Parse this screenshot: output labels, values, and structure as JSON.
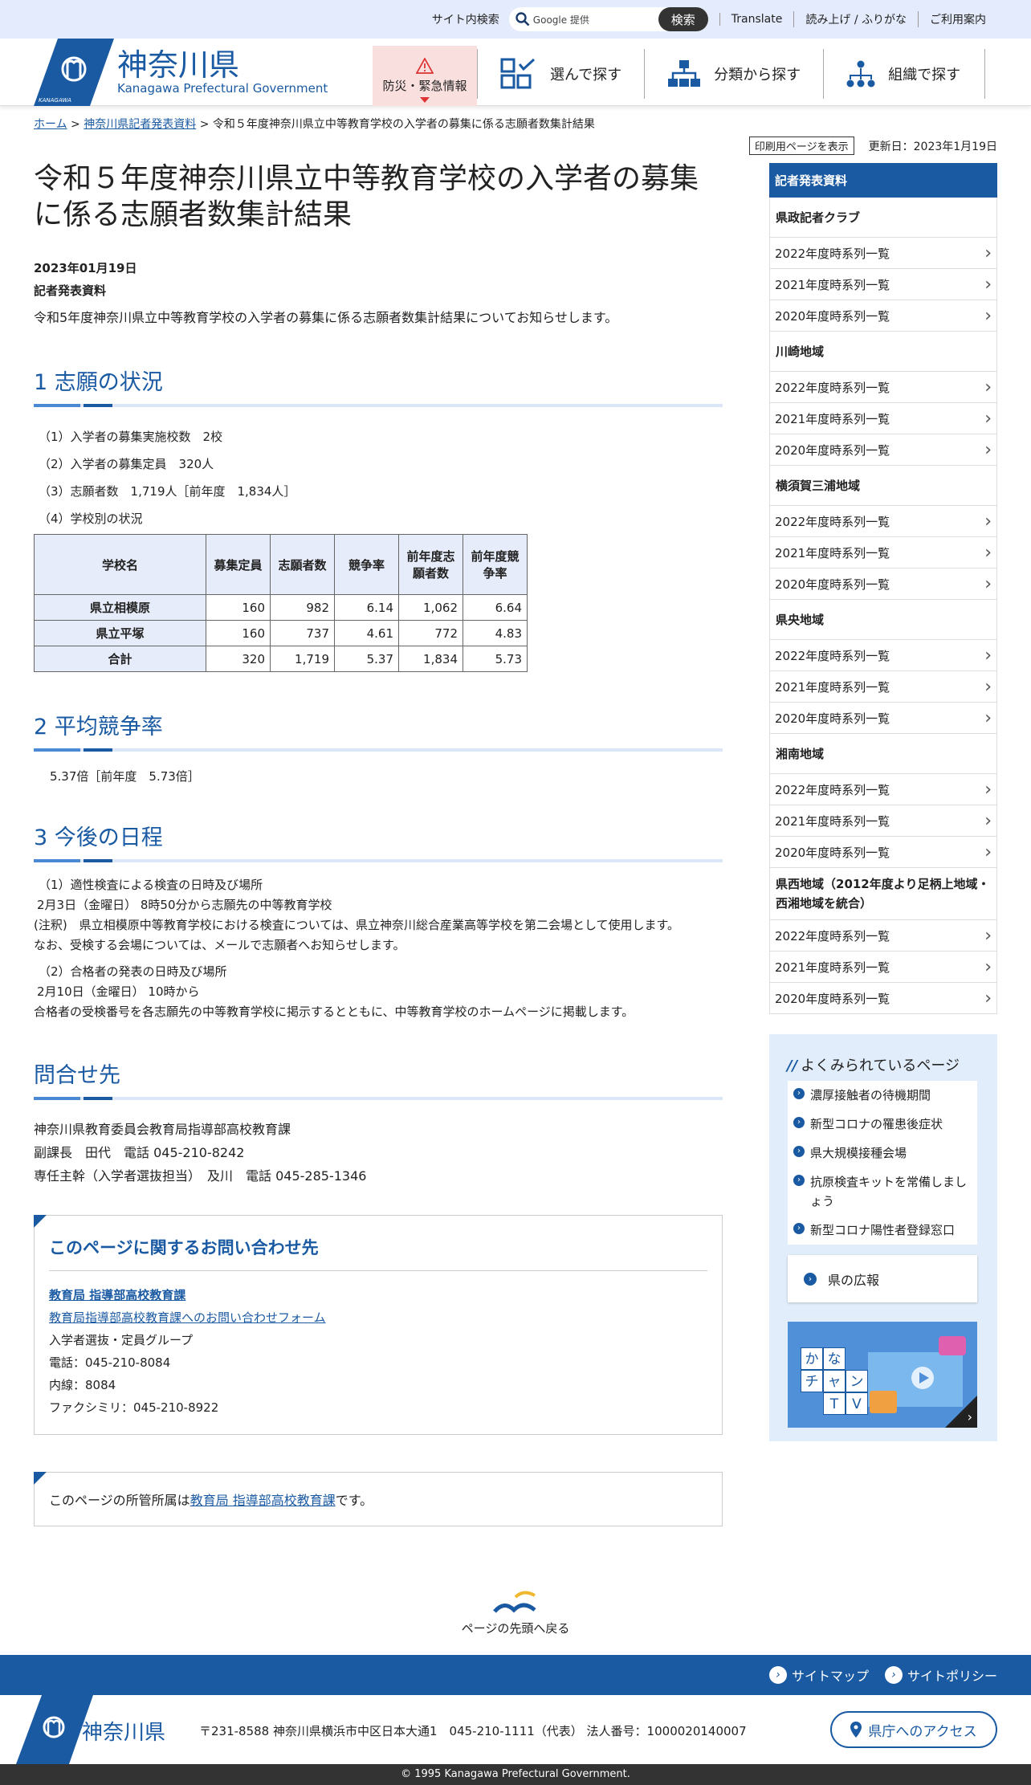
{
  "util": {
    "search_label": "サイト内検索",
    "search_placeholder": "Google 提供",
    "search_button": "検索",
    "links": [
      "Translate",
      "読み上げ / ふりがな",
      "ご利用案内"
    ]
  },
  "header": {
    "logo_ja": "神奈川県",
    "logo_en": "Kanagawa Prefectural Government",
    "emblem_text": "KANAGAWA",
    "emergency": "防災・緊急情報",
    "nav": [
      "選んで探す",
      "分類から探す",
      "組織で探す"
    ]
  },
  "breadcrumb": {
    "home": "ホーム",
    "sep": ">",
    "parent": "神奈川県記者発表資料",
    "current": "令和５年度神奈川県立中等教育学校の入学者の募集に係る志願者数集計結果"
  },
  "meta": {
    "print": "印刷用ページを表示",
    "updated": "更新日：2023年1月19日"
  },
  "main": {
    "title": "令和５年度神奈川県立中等教育学校の入学者の募集に係る志願者数集計結果",
    "date": "2023年01月19日",
    "category": "記者発表資料",
    "intro": "令和5年度神奈川県立中等教育学校の入学者の募集に係る志願者数集計結果についてお知らせします。",
    "sec1_title": "1 志願の状況",
    "sec1_items": [
      "（1）入学者の募集実施校数　2校",
      "（2）入学者の募集定員　320人",
      "（3）志願者数　1,719人［前年度　1,834人］",
      "（4）学校別の状況"
    ],
    "table": {
      "headers": [
        "学校名",
        "募集定員",
        "志願者数",
        "競争率",
        "前年度志願者数",
        "前年度競争率"
      ],
      "rows": [
        [
          "県立相模原",
          "160",
          "982",
          "6.14",
          "1,062",
          "6.64"
        ],
        [
          "県立平塚",
          "160",
          "737",
          "4.61",
          "772",
          "4.83"
        ],
        [
          "合計",
          "320",
          "1,719",
          "5.37",
          "1,834",
          "5.73"
        ]
      ]
    },
    "sec2_title": "2 平均競争率",
    "sec2_text": "5.37倍［前年度　5.73倍］",
    "sec3_title": "3 今後の日程",
    "sec3_lines": [
      "（1）適性検査による検査の日時及び場所",
      "2月3日（金曜日） 8時50分から志願先の中等教育学校",
      "(注釈)　県立相模原中等教育学校における検査については、県立神奈川総合産業高等学校を第二会場として使用します。",
      "なお、受検する会場については、メールで志願者へお知らせします。",
      "（2）合格者の発表の日時及び場所",
      "2月10日（金曜日） 10時から",
      "合格者の受検番号を各志願先の中等教育学校に掲示するとともに、中等教育学校のホームページに掲載します。"
    ],
    "sec4_title": "問合せ先",
    "sec4_lines": [
      "神奈川県教育委員会教育局指導部高校教育課",
      "副課長　田代　電話 045-210-8242",
      "専任主幹（入学者選抜担当）　及川　電話 045-285-1346"
    ]
  },
  "contact": {
    "title": "このページに関するお問い合わせ先",
    "dept_link": "教育局 指導部高校教育課",
    "form_link": "教育局指導部高校教育課へのお問い合わせフォーム",
    "lines": [
      "入学者選抜・定員グループ",
      "電話：045-210-8084",
      "内線：8084",
      "ファクシミリ：045-210-8922"
    ]
  },
  "owner": {
    "prefix": "このページの所管所属は",
    "link": "教育局 指導部高校教育課",
    "suffix": "です。"
  },
  "sidebar": {
    "title": "記者発表資料",
    "groups": [
      {
        "name": "県政記者クラブ",
        "items": [
          "2022年度時系列一覧",
          "2021年度時系列一覧",
          "2020年度時系列一覧"
        ]
      },
      {
        "name": "川崎地域",
        "items": [
          "2022年度時系列一覧",
          "2021年度時系列一覧",
          "2020年度時系列一覧"
        ]
      },
      {
        "name": "横須賀三浦地域",
        "items": [
          "2022年度時系列一覧",
          "2021年度時系列一覧",
          "2020年度時系列一覧"
        ]
      },
      {
        "name": "県央地域",
        "items": [
          "2022年度時系列一覧",
          "2021年度時系列一覧",
          "2020年度時系列一覧"
        ]
      },
      {
        "name": "湘南地域",
        "items": [
          "2022年度時系列一覧",
          "2021年度時系列一覧",
          "2020年度時系列一覧"
        ]
      },
      {
        "name": "県西地域（2012年度より足柄上地域・西湘地域を統合）",
        "items": [
          "2022年度時系列一覧",
          "2021年度時系列一覧",
          "2020年度時系列一覧"
        ]
      }
    ]
  },
  "popular": {
    "title": "よくみられているページ",
    "items": [
      "濃厚接触者の待機期間",
      "新型コロナの罹患後症状",
      "県大規模接種会場",
      "抗原検査キットを常備しましょう",
      "新型コロナ陽性者登録窓口"
    ],
    "koho": "県の広報",
    "tv_chars": [
      "か",
      "な",
      "チ",
      "ャ",
      "ン",
      "T",
      "V"
    ]
  },
  "footer": {
    "back_to_top": "ページの先頭へ戻る",
    "links": [
      "サイトマップ",
      "サイトポリシー"
    ],
    "logo": "神奈川県",
    "address": "〒231-8588 神奈川県横浜市中区日本大通1　045-210-1111（代表） 法人番号：1000020140007",
    "access": "県庁へのアクセス",
    "copyright": "© 1995 Kanagawa Prefectural Government."
  },
  "colors": {
    "brand": "#1a5aa3",
    "util_bg": "#e4ebfc",
    "emergency_bg": "#fadfdf"
  }
}
